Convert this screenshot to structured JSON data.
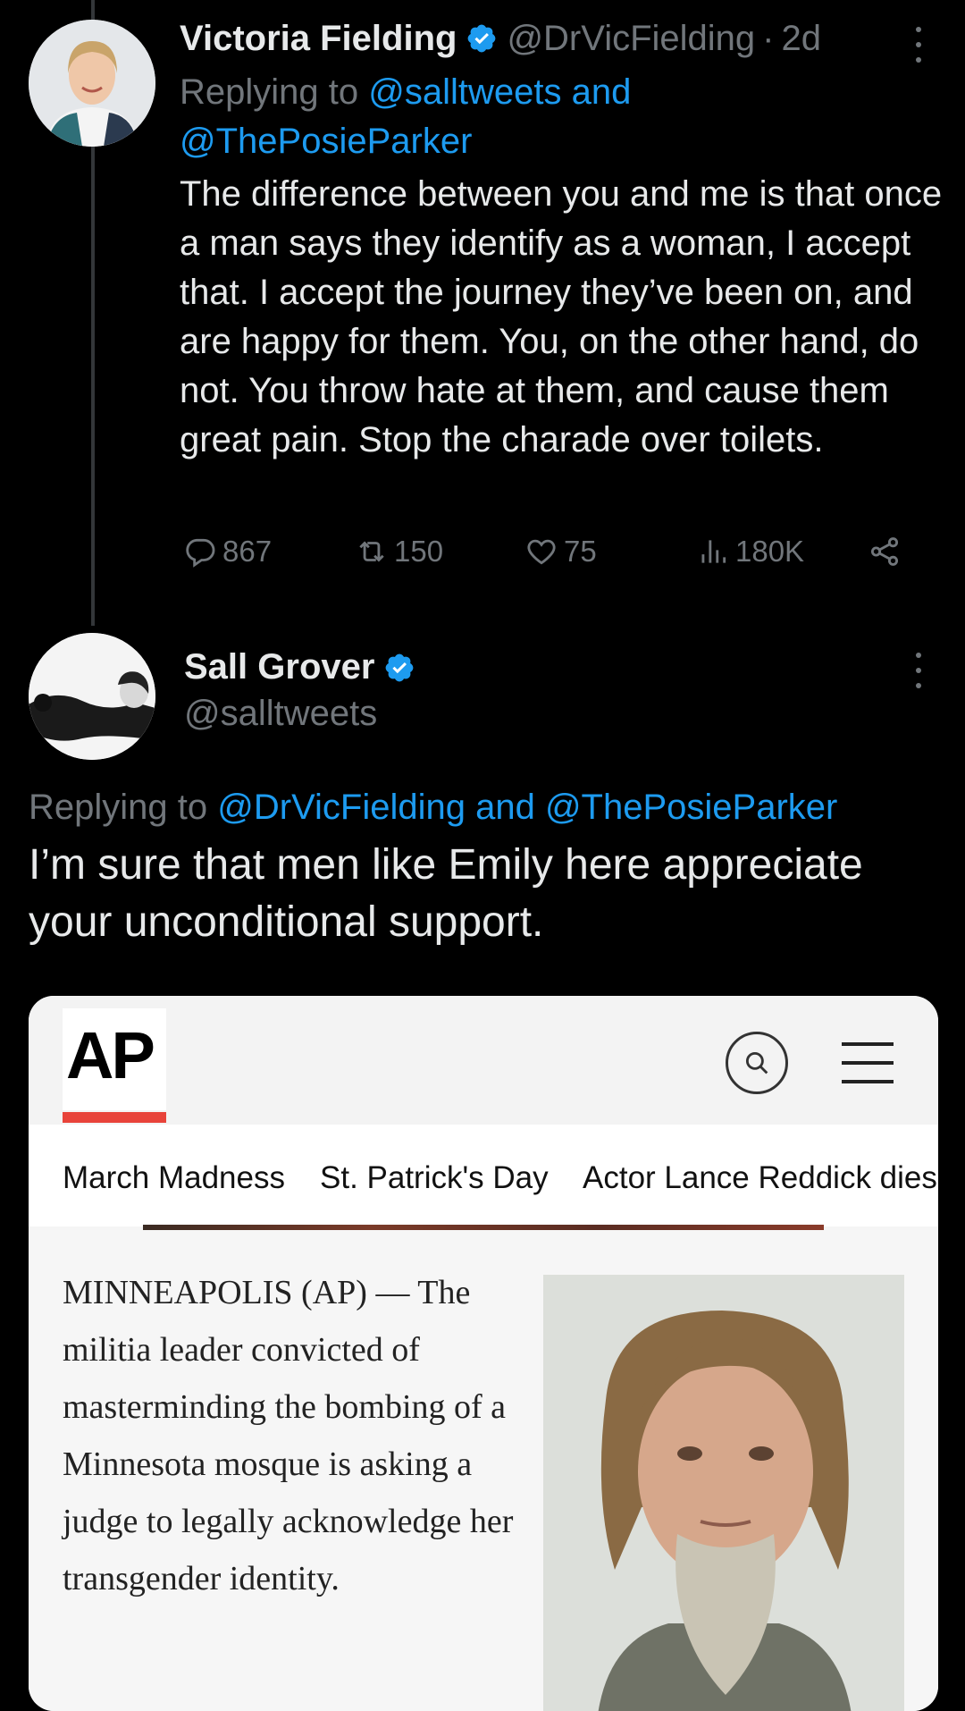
{
  "tweet1": {
    "display_name": "Victoria Fielding",
    "handle": "@DrVicFielding",
    "separator": "·",
    "time": "2d",
    "replying_prefix": "Replying to",
    "replying_to": "@salltweets and @ThePosieParker",
    "body": "The difference between you and me is that once a man says they identify as a woman, I accept that. I accept the journey they’ve been on, and are happy for them. You, on the other hand, do not. You throw hate at them, and cause them great pain. Stop the charade over toilets.",
    "replies": "867",
    "retweets": "150",
    "likes": "75",
    "views": "180K"
  },
  "tweet2": {
    "display_name": "Sall Grover",
    "handle": "@salltweets",
    "replying_prefix": "Replying to",
    "replying_to": "@DrVicFielding and @ThePosieParker",
    "body": "I’m sure that men like Emily here appreciate your unconditional support."
  },
  "embed": {
    "logo": "AP",
    "nav": [
      "March Madness",
      "St. Patrick's Day",
      "Actor Lance Reddick dies"
    ],
    "article_text": "MINNEAPOLIS (AP) — The militia leader convicted of masterminding the bombing of a Minnesota mosque is asking a judge to legally acknowledge her transgender identity."
  },
  "colors": {
    "background": "#000000",
    "text": "#e7e9ea",
    "muted": "#71767b",
    "link": "#1d9bf0",
    "verified": "#1d9bf0",
    "ap_red": "#e8433a"
  },
  "icons": [
    "verified-badge-icon",
    "more-icon",
    "reply-icon",
    "retweet-icon",
    "like-icon",
    "views-icon",
    "share-icon",
    "search-icon",
    "menu-icon"
  ]
}
